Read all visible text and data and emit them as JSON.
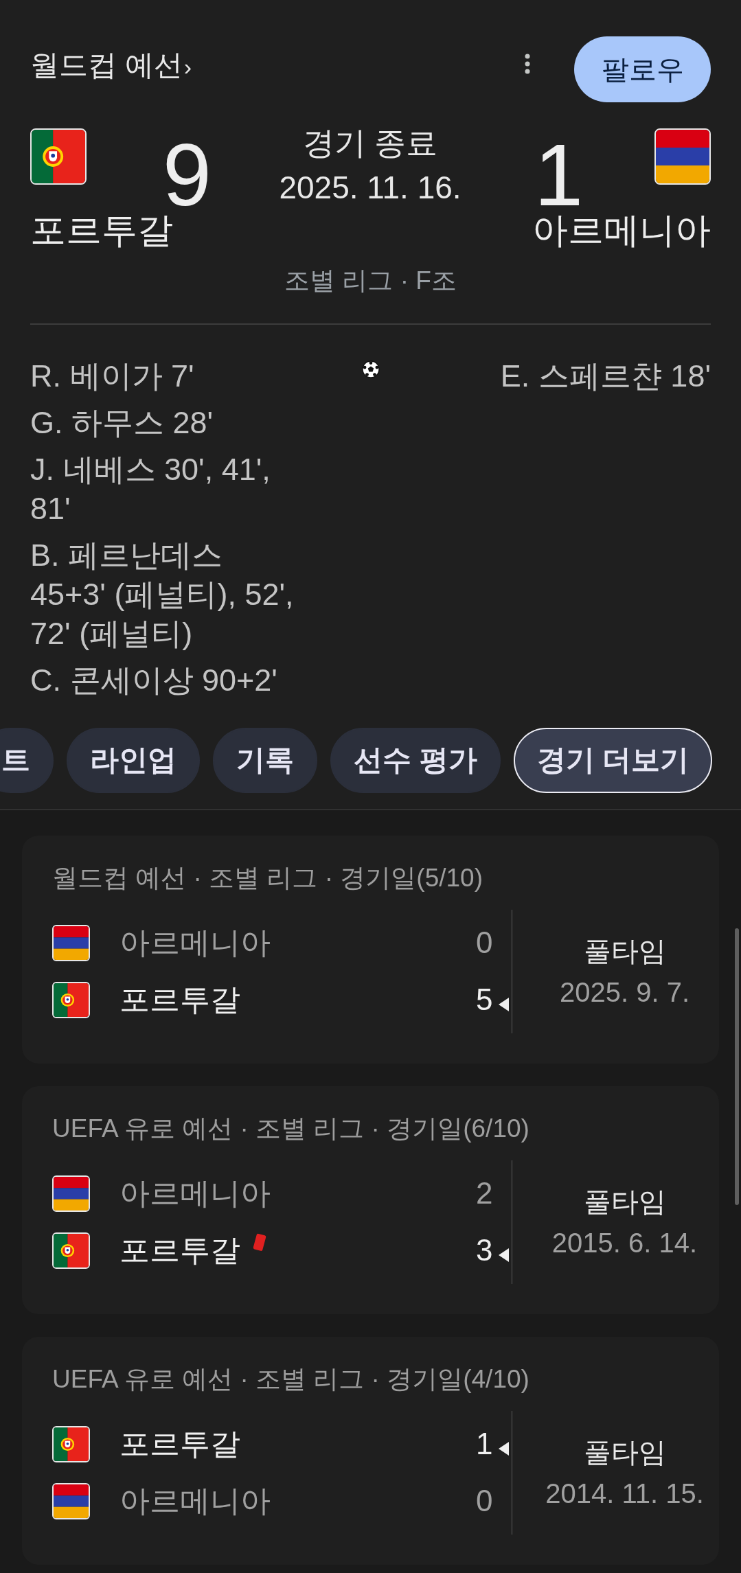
{
  "header": {
    "title": "월드컵 예선",
    "chevron": "›",
    "follow_button": "팔로우"
  },
  "match": {
    "teams": [
      {
        "kind": "portugal",
        "name": "포르투갈",
        "score": "9"
      },
      {
        "kind": "armenia",
        "name": "아르메니아",
        "score": "1"
      }
    ],
    "status": "경기 종료",
    "date": "2025. 11. 16.",
    "stage": "조별 리그 · F조"
  },
  "goals": {
    "home": [
      "R. 베이가 7'",
      "G. 하무스 28'",
      "J. 네베스 30', 41', 81'",
      "B. 페르난데스 45+3' (페널티), 52', 72' (페널티)",
      "C. 콘세이상 90+2'"
    ],
    "away": [
      "E. 스페르챤 18'"
    ]
  },
  "tabs": [
    {
      "label": "트",
      "selected": false
    },
    {
      "label": "라인업",
      "selected": false
    },
    {
      "label": "기록",
      "selected": false
    },
    {
      "label": "선수 평가",
      "selected": false
    },
    {
      "label": "경기 더보기",
      "selected": true
    }
  ],
  "recent_matches": [
    {
      "title": "월드컵 예선 · 조별 리그 · 경기일(5/10)",
      "teams": [
        {
          "kind": "armenia",
          "name": "아르메니아",
          "score": "0",
          "winner": false,
          "red_card": false
        },
        {
          "kind": "portugal",
          "name": "포르투갈",
          "score": "5",
          "winner": true,
          "red_card": false
        }
      ],
      "status": "풀타임",
      "date": "2025. 9. 7."
    },
    {
      "title": "UEFA 유로 예선 · 조별 리그 · 경기일(6/10)",
      "teams": [
        {
          "kind": "armenia",
          "name": "아르메니아",
          "score": "2",
          "winner": false,
          "red_card": false
        },
        {
          "kind": "portugal",
          "name": "포르투갈",
          "score": "3",
          "winner": true,
          "red_card": true
        }
      ],
      "status": "풀타임",
      "date": "2015. 6. 14."
    },
    {
      "title": "UEFA 유로 예선 · 조별 리그 · 경기일(4/10)",
      "teams": [
        {
          "kind": "portugal",
          "name": "포르투갈",
          "score": "1",
          "winner": true,
          "red_card": false
        },
        {
          "kind": "armenia",
          "name": "아르메니아",
          "score": "0",
          "winner": false,
          "red_card": false
        }
      ],
      "status": "풀타임",
      "date": "2014. 11. 15."
    }
  ]
}
